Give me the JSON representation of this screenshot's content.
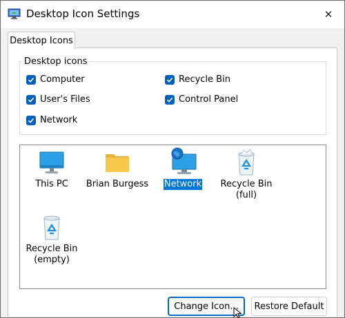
{
  "window": {
    "title": "Desktop Icon Settings",
    "close_symbol": "✕"
  },
  "tab": {
    "label": "Desktop Icons"
  },
  "group": {
    "legend": "Desktop icons",
    "checkboxes": [
      {
        "label": "Computer",
        "checked": true
      },
      {
        "label": "Recycle Bin",
        "checked": true
      },
      {
        "label": "User's Files",
        "checked": true
      },
      {
        "label": "Control Panel",
        "checked": true
      },
      {
        "label": "Network",
        "checked": true
      }
    ]
  },
  "icons": [
    {
      "label": "This PC",
      "icon": "monitor-icon",
      "selected": false
    },
    {
      "label": "Brian Burgess",
      "icon": "folder-icon",
      "selected": false
    },
    {
      "label": "Network",
      "icon": "network-icon",
      "selected": true
    },
    {
      "label": "Recycle Bin\n(full)",
      "icon": "recycle-bin-full-icon",
      "selected": false
    },
    {
      "label": "Recycle Bin\n(empty)",
      "icon": "recycle-bin-empty-icon",
      "selected": false
    }
  ],
  "buttons": {
    "change_icon": "Change Icon...",
    "restore_default": "Restore Default"
  },
  "colors": {
    "accent": "#005fb8",
    "selection": "#0078d7",
    "monitor": "#2ea1e6",
    "folder": "#f8c84a"
  }
}
